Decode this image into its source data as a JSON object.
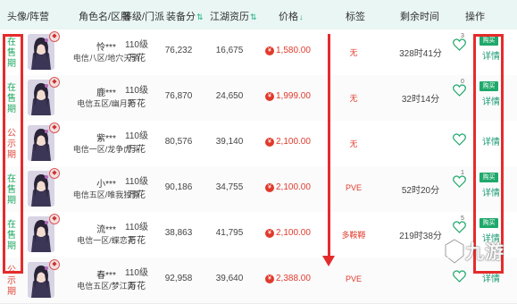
{
  "header": {
    "avatar_camp": "头像/阵营",
    "role_server": "角色名/区服",
    "level_school": "等级/门派",
    "gear_score": "装备分",
    "jianghu": "江湖资历",
    "price": "价格",
    "tags": "标签",
    "remaining": "剩余时间",
    "action": "操作"
  },
  "rows": [
    {
      "status": "在售期",
      "status_color": "green",
      "name": "怜***",
      "server": "电信八区/地穴天骄",
      "level": "110级",
      "school": "万花",
      "gear": "76,232",
      "exp": "16,675",
      "price": "1,580.00",
      "tag": "无",
      "remain": "328时41分",
      "likes": "3",
      "has_buy": true,
      "detail": "详情"
    },
    {
      "status": "在售期",
      "status_color": "green",
      "name": "鹿***",
      "server": "电信五区/幽月轮",
      "level": "110级",
      "school": "万花",
      "gear": "76,870",
      "exp": "24,650",
      "price": "1,999.00",
      "tag": "无",
      "remain": "32时14分",
      "likes": "0",
      "has_buy": true,
      "detail": "详情"
    },
    {
      "status": "公示期",
      "status_color": "red",
      "name": "紫***",
      "server": "电信一区/龙争虎斗",
      "level": "110级",
      "school": "万花",
      "gear": "80,576",
      "exp": "39,140",
      "price": "2,100.00",
      "tag": "无",
      "remain": "",
      "likes": "",
      "has_buy": false,
      "detail": "详情"
    },
    {
      "status": "在售期",
      "status_color": "green",
      "name": "小***",
      "server": "电信五区/唯我独尊",
      "level": "110级",
      "school": "万花",
      "gear": "90,186",
      "exp": "34,755",
      "price": "2,100.00",
      "tag": "PVE",
      "remain": "52时20分",
      "likes": "1",
      "has_buy": true,
      "detail": "详情"
    },
    {
      "status": "在售期",
      "status_color": "green",
      "name": "流***",
      "server": "电信一区/蝶恋花",
      "level": "110级",
      "school": "万花",
      "gear": "38,863",
      "exp": "41,795",
      "price": "2,100.00",
      "tag": "多鞍鞯",
      "remain": "219时38分",
      "likes": "5",
      "has_buy": true,
      "detail": "详情"
    },
    {
      "status": "公示期",
      "status_color": "red",
      "name": "春***",
      "server": "电信五区/梦江南",
      "level": "110级",
      "school": "万花",
      "gear": "92,958",
      "exp": "39,640",
      "price": "2,388.00",
      "tag": "PVE",
      "remain": "",
      "likes": "",
      "has_buy": false,
      "detail": "详情"
    }
  ],
  "buy_label": "购买",
  "currency_symbol": "¥",
  "watermark": "九游",
  "colors": {
    "accent": "#1fa86b",
    "price": "#e03a2c",
    "highlight": "#e52b2b",
    "header_bg": "#e9f6f3"
  }
}
